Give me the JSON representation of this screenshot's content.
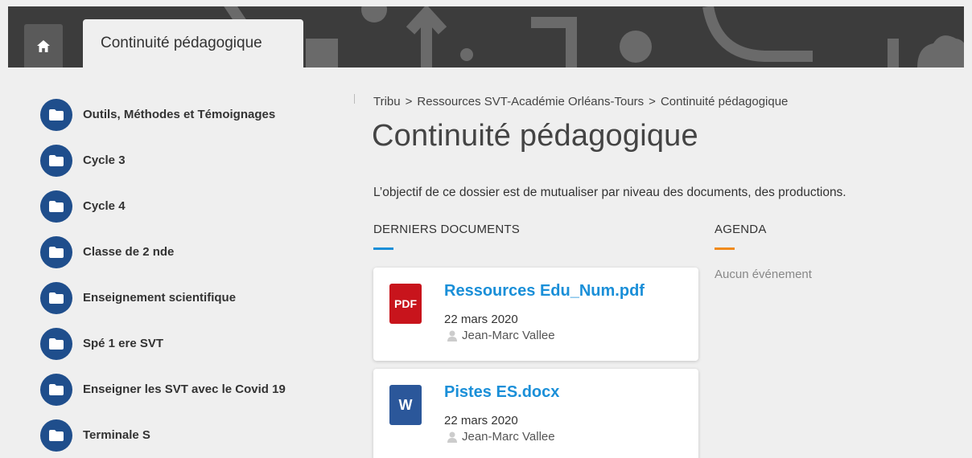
{
  "header": {
    "home_label": "",
    "section_tab": "Continuité pédagogique"
  },
  "sidebar": {
    "items": [
      {
        "label": "Outils, Méthodes et Témoignages"
      },
      {
        "label": "Cycle 3"
      },
      {
        "label": "Cycle 4"
      },
      {
        "label": "Classe de 2 nde"
      },
      {
        "label": "Enseignement scientifique"
      },
      {
        "label": "Spé 1 ere SVT"
      },
      {
        "label": "Enseigner les SVT avec le Covid 19"
      },
      {
        "label": "Terminale S"
      }
    ]
  },
  "breadcrumb": {
    "items": [
      "Tribu",
      "Ressources SVT-Académie Orléans-Tours",
      "Continuité pédagogique"
    ],
    "separator": ">"
  },
  "main": {
    "title": "Continuité pédagogique",
    "intro": "L’objectif de ce dossier est de mutualiser par niveau des documents, des productions."
  },
  "documents": {
    "heading": "DERNIERS DOCUMENTS",
    "accent": "#1a8fd8",
    "items": [
      {
        "title": "Ressources Edu_Num.pdf",
        "type_badge": "PDF",
        "badge_color": "#c8141c",
        "date": "22 mars 2020",
        "author": "Jean-Marc Vallee"
      },
      {
        "title": "Pistes ES.docx",
        "type_badge": "W",
        "badge_color": "#2b579a",
        "date": "22 mars 2020",
        "author": "Jean-Marc Vallee"
      }
    ]
  },
  "agenda": {
    "heading": "AGENDA",
    "accent": "#f08a1c",
    "empty_text": "Aucun événement"
  },
  "icons": {
    "home": "home-icon",
    "folder": "folder-icon",
    "user": "user-icon"
  }
}
